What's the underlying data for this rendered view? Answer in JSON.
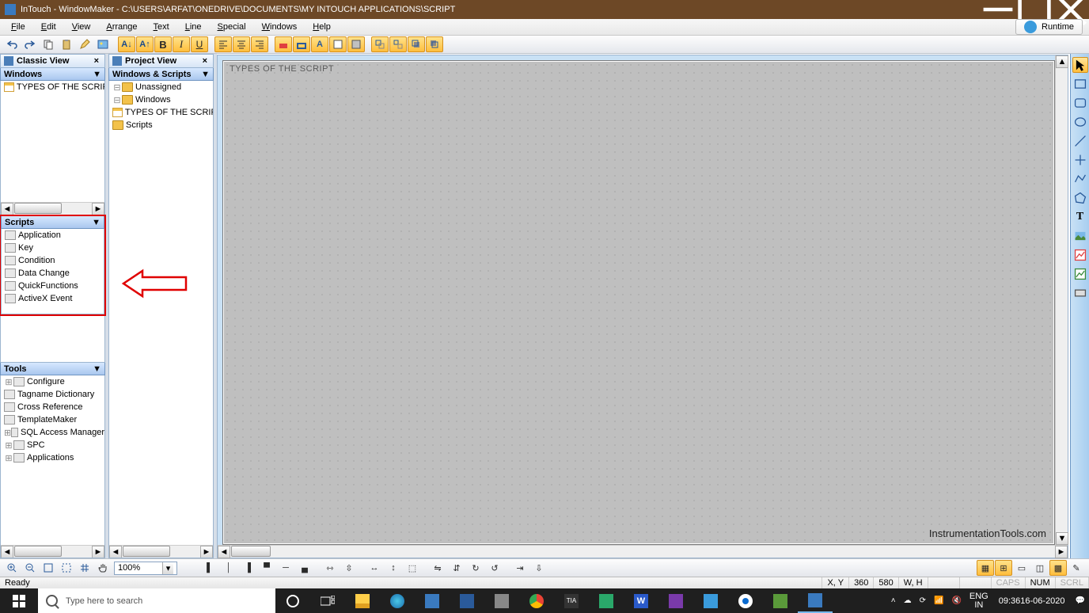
{
  "title": "InTouch - WindowMaker - C:\\USERS\\ARFAT\\ONEDRIVE\\DOCUMENTS\\MY INTOUCH APPLICATIONS\\SCRIPT",
  "menu": {
    "file": "File",
    "edit": "Edit",
    "view": "View",
    "arrange": "Arrange",
    "text": "Text",
    "line": "Line",
    "special": "Special",
    "windows": "Windows",
    "help": "Help",
    "runtime": "Runtime"
  },
  "panes": {
    "classic": "Classic View",
    "project": "Project View",
    "windows": "Windows",
    "winscripts": "Windows & Scripts",
    "scripts": "Scripts",
    "tools": "Tools"
  },
  "windows_tree": {
    "item": "TYPES OF THE SCRIPT"
  },
  "project_tree": {
    "unassigned": "Unassigned",
    "windows": "Windows",
    "types": "TYPES OF THE SCRIPT",
    "scripts": "Scripts"
  },
  "scripts_list": [
    "Application",
    "Key",
    "Condition",
    "Data Change",
    "QuickFunctions",
    "ActiveX Event"
  ],
  "tools_list": [
    "Configure",
    "Tagname Dictionary",
    "Cross Reference",
    "TemplateMaker",
    "SQL Access Manager",
    "SPC",
    "Applications"
  ],
  "canvas": {
    "title": "TYPES OF THE SCRIPT",
    "watermark": "InstrumentationTools.com"
  },
  "zoom": "100%",
  "status": {
    "ready": "Ready",
    "xy": "X, Y",
    "xval": "360",
    "yval": "580",
    "wh": "W, H",
    "caps": "CAPS",
    "num": "NUM",
    "scrl": "SCRL"
  },
  "taskbar": {
    "search_placeholder": "Type here to search",
    "lang": "ENG",
    "region": "IN",
    "time": "09:36",
    "date": "16-06-2020"
  }
}
